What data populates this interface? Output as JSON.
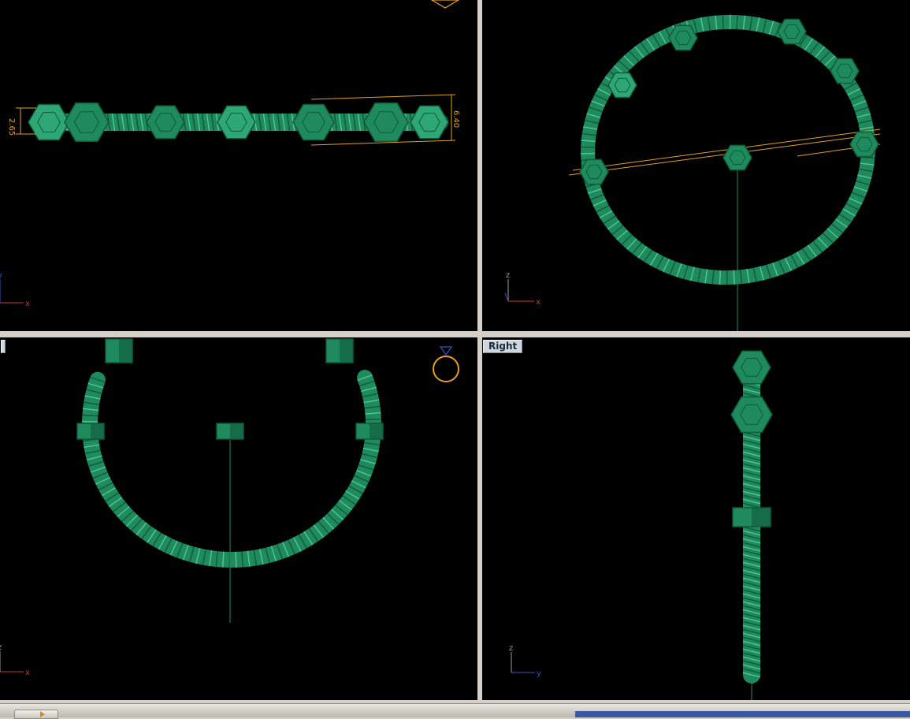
{
  "viewports": {
    "top": {
      "label": "",
      "dim_height": "2.65",
      "dim_width": "6.40",
      "axis_x": "x",
      "axis_y": "y"
    },
    "perspective": {
      "label": "",
      "axis_x": "x",
      "axis_z": "z"
    },
    "front": {
      "label": "",
      "axis_x": "x",
      "axis_z": "z"
    },
    "right": {
      "label": "Right",
      "axis_y": "y",
      "axis_z": "z"
    }
  },
  "colors": {
    "background": "#000000",
    "model_green": "#1f8a5c",
    "model_green_dark": "#0e5a3a",
    "model_green_light": "#4fc79a",
    "dimension": "#e3a21a",
    "axis_x": "#c8392b",
    "axis_y": "#3a55c4",
    "axis_z": "#9b9b9b",
    "separator": "#d4d0c8"
  },
  "icons": [
    "ring-gem-icon",
    "axis-triad-icon",
    "start-button-icon"
  ]
}
